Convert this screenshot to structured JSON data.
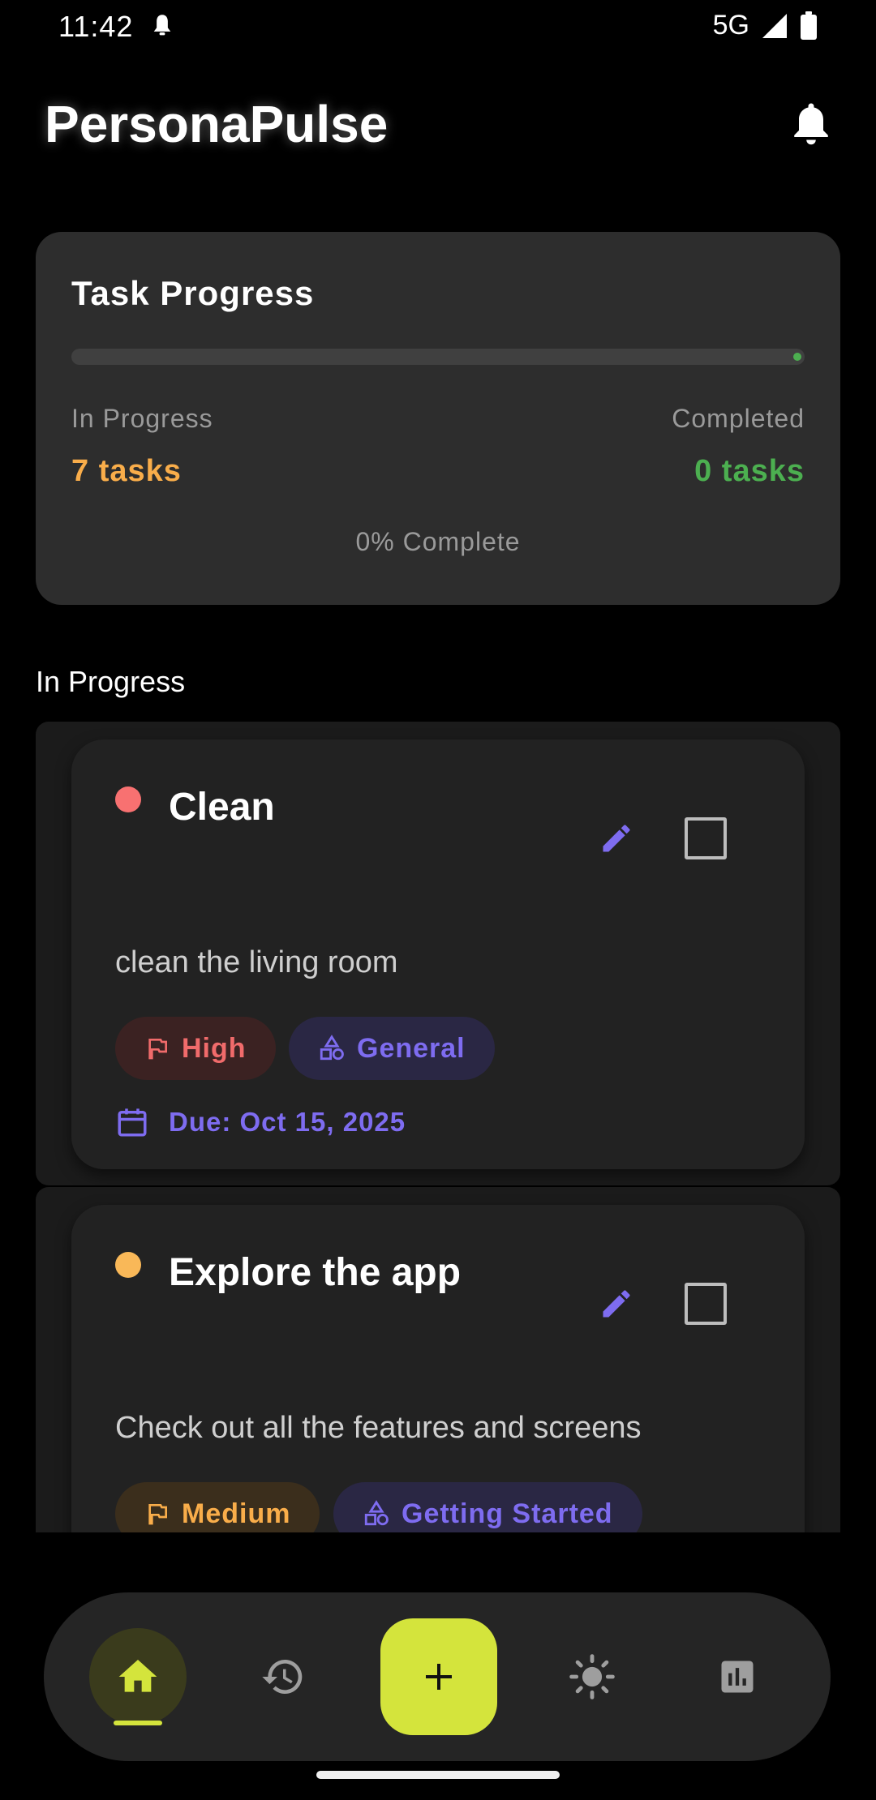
{
  "status_bar": {
    "time": "11:42",
    "network": "5G"
  },
  "app": {
    "title": "PersonaPulse"
  },
  "progress_card": {
    "title": "Task Progress",
    "progress_fraction": 0.0,
    "in_progress_label": "In Progress",
    "in_progress_value": "7 tasks",
    "completed_label": "Completed",
    "completed_value": "0 tasks",
    "percent_text": "0% Complete"
  },
  "section": {
    "title": "In Progress"
  },
  "tasks": [
    {
      "title": "Clean",
      "description": "clean the living room",
      "priority": "High",
      "category": "General",
      "due": "Due: Oct 15, 2025",
      "dot_color": "#f87171",
      "checked": false
    },
    {
      "title": "Explore the app",
      "description": "Check out all the features and screens",
      "priority": "Medium",
      "category": "Getting Started",
      "dot_color": "#f9b858",
      "checked": false
    }
  ],
  "bottom_nav": {
    "items": [
      "home-icon",
      "history-icon",
      "add-icon",
      "theme-icon",
      "stats-icon"
    ],
    "active": "home-icon"
  },
  "colors": {
    "accent": "#d4e43c",
    "purple": "#7e6cf0",
    "orange": "#f9ad4a",
    "green": "#4caf50",
    "red": "#f06b6b"
  }
}
